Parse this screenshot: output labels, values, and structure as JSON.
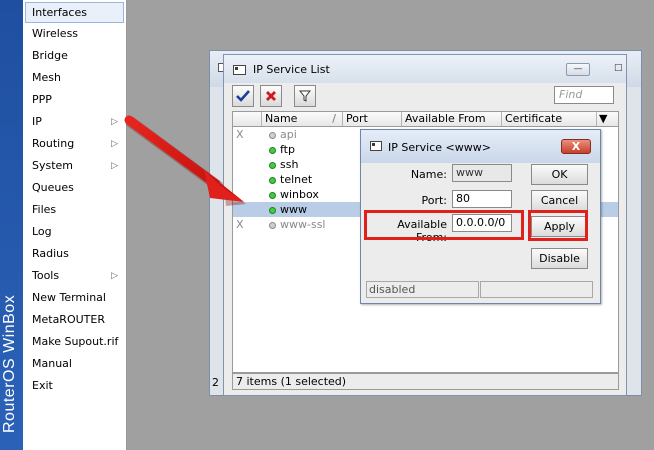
{
  "brand": {
    "text": "RouterOS WinBox"
  },
  "menu": {
    "items": [
      {
        "label": "Interfaces",
        "has_submenu": false
      },
      {
        "label": "Wireless",
        "has_submenu": false
      },
      {
        "label": "Bridge",
        "has_submenu": false
      },
      {
        "label": "Mesh",
        "has_submenu": false
      },
      {
        "label": "PPP",
        "has_submenu": false
      },
      {
        "label": "IP",
        "has_submenu": true
      },
      {
        "label": "Routing",
        "has_submenu": true
      },
      {
        "label": "System",
        "has_submenu": true
      },
      {
        "label": "Queues",
        "has_submenu": false
      },
      {
        "label": "Files",
        "has_submenu": false
      },
      {
        "label": "Log",
        "has_submenu": false
      },
      {
        "label": "Radius",
        "has_submenu": false
      },
      {
        "label": "Tools",
        "has_submenu": true
      },
      {
        "label": "New Terminal",
        "has_submenu": false
      },
      {
        "label": "MetaROUTER",
        "has_submenu": false
      },
      {
        "label": "Make Supout.rif",
        "has_submenu": false
      },
      {
        "label": "Manual",
        "has_submenu": false
      },
      {
        "label": "Exit",
        "has_submenu": false
      }
    ]
  },
  "list_window": {
    "title": "IP Service List",
    "find_placeholder": "Find",
    "columns": [
      "",
      "Name",
      "Port",
      "Available From",
      "Certificate"
    ],
    "sort_indicator": "/",
    "rows": [
      {
        "flag": "X",
        "name": "api",
        "enabled": false,
        "selected": false
      },
      {
        "flag": "",
        "name": "ftp",
        "enabled": true,
        "selected": false
      },
      {
        "flag": "",
        "name": "ssh",
        "enabled": true,
        "selected": false
      },
      {
        "flag": "",
        "name": "telnet",
        "enabled": true,
        "selected": false
      },
      {
        "flag": "",
        "name": "winbox",
        "enabled": true,
        "selected": false
      },
      {
        "flag": "",
        "name": "www",
        "enabled": true,
        "selected": true
      },
      {
        "flag": "X",
        "name": "www-ssl",
        "enabled": false,
        "selected": false
      }
    ],
    "status": "7 items (1 selected)"
  },
  "back_window": {
    "side_chars": [
      "D",
      "2"
    ]
  },
  "dialog": {
    "title": "IP Service <www>",
    "close_label": "X",
    "name_label": "Name:",
    "name_value": "www",
    "port_label": "Port:",
    "port_value": "80",
    "available_label": "Available From:",
    "available_value": "0.0.0.0/0",
    "buttons": {
      "ok": "OK",
      "cancel": "Cancel",
      "apply": "Apply",
      "disable": "Disable"
    },
    "status": "disabled"
  },
  "colors": {
    "annotation": "#e0201b",
    "selection": "#b9cde6",
    "brand": "#2b62b8"
  }
}
